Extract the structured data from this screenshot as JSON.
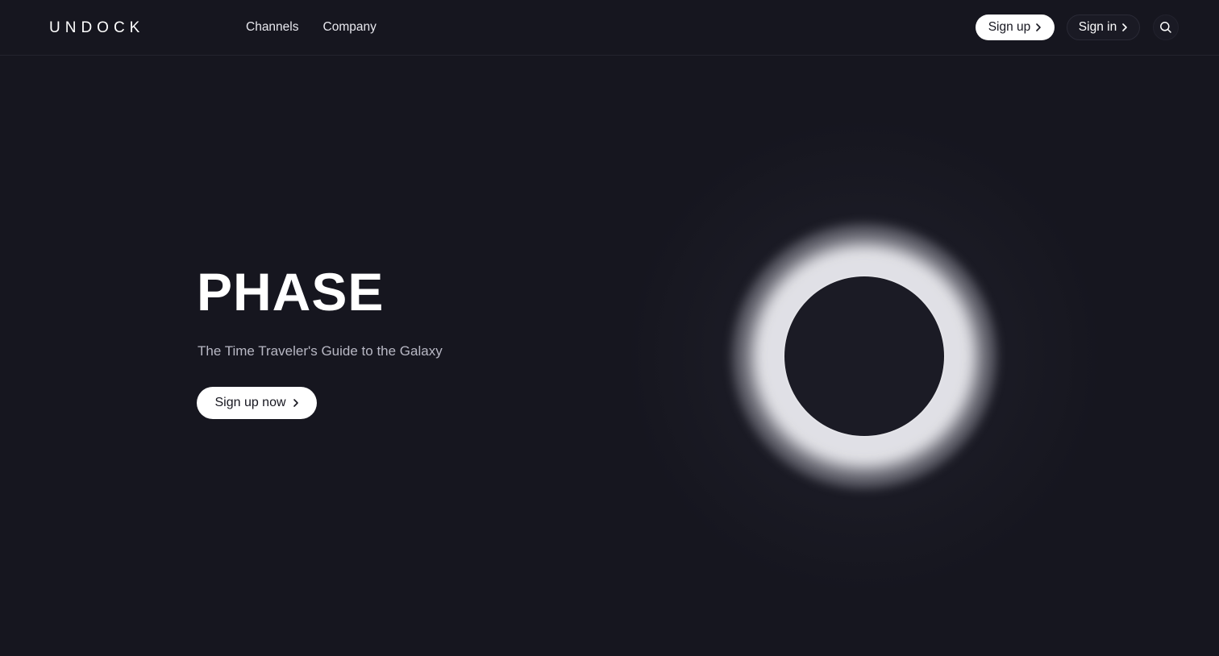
{
  "header": {
    "logo": "UNDOCK",
    "nav": [
      {
        "label": "Channels"
      },
      {
        "label": "Company"
      }
    ],
    "signup_label": "Sign up",
    "signin_label": "Sign in"
  },
  "hero": {
    "title": "PHASE",
    "subtitle": "The Time Traveler's Guide to the Galaxy",
    "cta_label": "Sign up now"
  },
  "icons": {
    "search": "search-icon",
    "chevron": "chevron-right-icon"
  },
  "colors": {
    "background": "#16161f",
    "button_light": "#ffffff",
    "text_muted": "#b8b8c4"
  }
}
